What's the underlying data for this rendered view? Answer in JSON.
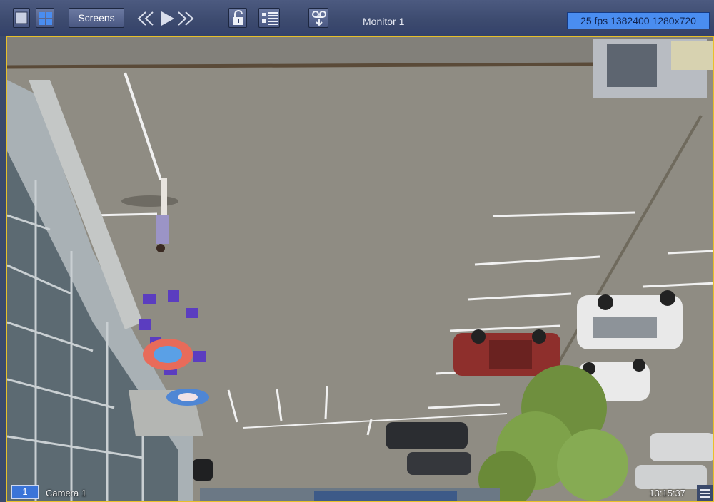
{
  "toolbar": {
    "screens_label": "Screens",
    "monitor_label": "Monitor 1",
    "stream_info": "25 fps 1382400 1280x720"
  },
  "viewport": {
    "camera_number": "1",
    "camera_name": "Camera 1",
    "timestamp": "13:15:37"
  },
  "icons": {
    "single_layout": "single-view-icon",
    "grid_layout": "grid-view-icon",
    "prev": "double-chevron-left-icon",
    "play": "play-icon",
    "next": "double-chevron-right-icon",
    "lock": "unlock-icon",
    "list": "locked-list-icon",
    "tape": "archive-download-icon",
    "menu": "hamburger-menu-icon"
  },
  "colors": {
    "toolbar": "#3c4a6e",
    "active_border": "#e7c02a",
    "badge": "#4a8df0"
  }
}
